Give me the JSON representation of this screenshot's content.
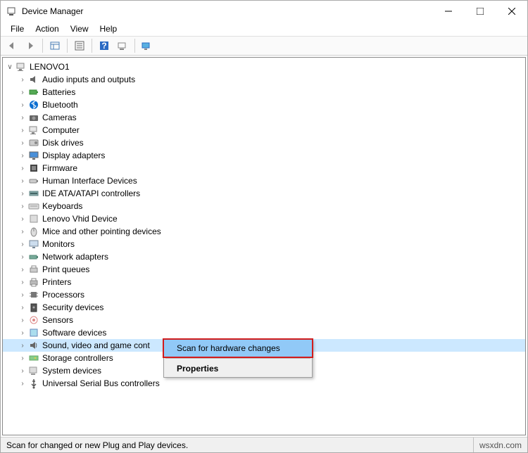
{
  "window": {
    "title": "Device Manager"
  },
  "menu": {
    "file": "File",
    "action": "Action",
    "view": "View",
    "help": "Help"
  },
  "tree": {
    "root": "LENOVO1",
    "items": [
      "Audio inputs and outputs",
      "Batteries",
      "Bluetooth",
      "Cameras",
      "Computer",
      "Disk drives",
      "Display adapters",
      "Firmware",
      "Human Interface Devices",
      "IDE ATA/ATAPI controllers",
      "Keyboards",
      "Lenovo Vhid Device",
      "Mice and other pointing devices",
      "Monitors",
      "Network adapters",
      "Print queues",
      "Printers",
      "Processors",
      "Security devices",
      "Sensors",
      "Software devices",
      "Sound, video and game cont",
      "Storage controllers",
      "System devices",
      "Universal Serial Bus controllers"
    ],
    "selected_index": 21
  },
  "context_menu": {
    "scan": "Scan for hardware changes",
    "properties": "Properties"
  },
  "status": {
    "text": "Scan for changed or new Plug and Play devices.",
    "brand": "wsxdn.com"
  }
}
